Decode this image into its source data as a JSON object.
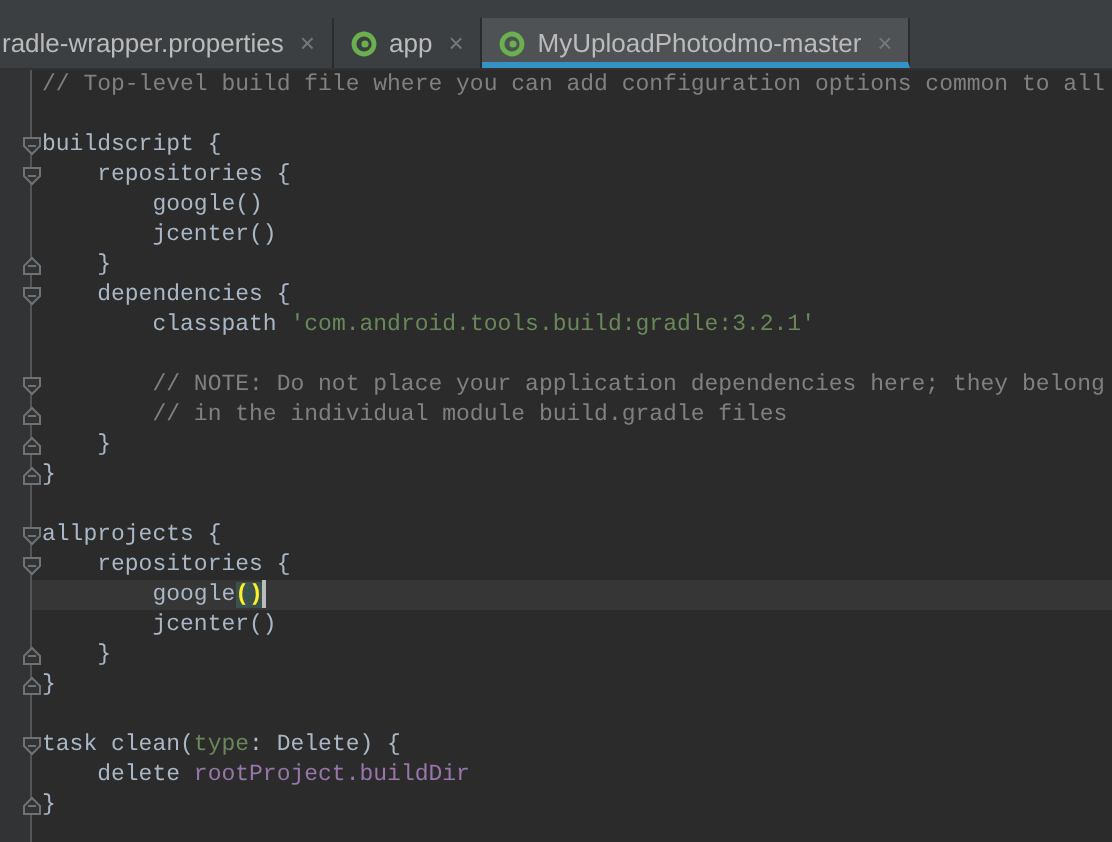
{
  "tabs": [
    {
      "label": "radle-wrapper.properties",
      "icon": false,
      "close": "×",
      "selected": false
    },
    {
      "label": "app",
      "icon": true,
      "close": "×",
      "selected": false
    },
    {
      "label": "MyUploadPhotodmo-master",
      "icon": true,
      "close": "×",
      "selected": true
    }
  ],
  "editor": {
    "lines": [
      {
        "fold_start": false,
        "fold_end": false,
        "segments": [
          {
            "kind": "comment",
            "text": "// Top-level build file where you can add configuration options common to all"
          }
        ]
      },
      {
        "fold_start": false,
        "fold_end": false
      },
      {
        "fold_start": true,
        "fold_end": false,
        "segments": [
          {
            "kind": "plain",
            "text": "buildscript {"
          }
        ]
      },
      {
        "fold_start": true,
        "fold_end": false,
        "segments": [
          {
            "kind": "plain",
            "text": "    repositories {"
          }
        ]
      },
      {
        "fold_start": false,
        "fold_end": false,
        "segments": [
          {
            "kind": "plain",
            "text": "        google()"
          }
        ]
      },
      {
        "fold_start": false,
        "fold_end": false,
        "segments": [
          {
            "kind": "plain",
            "text": "        jcenter()"
          }
        ]
      },
      {
        "fold_start": false,
        "fold_end": true,
        "segments": [
          {
            "kind": "plain",
            "text": "    }"
          }
        ]
      },
      {
        "fold_start": true,
        "fold_end": false,
        "segments": [
          {
            "kind": "plain",
            "text": "    dependencies {"
          }
        ]
      },
      {
        "fold_start": false,
        "fold_end": false,
        "segments": [
          {
            "kind": "plain",
            "text": "        classpath "
          },
          {
            "kind": "string",
            "text": "'com.android.tools.build:gradle:3.2.1'"
          }
        ]
      },
      {
        "fold_start": false,
        "fold_end": false
      },
      {
        "fold_start": true,
        "fold_end": false,
        "segments": [
          {
            "kind": "comment",
            "text": "        // NOTE: Do not place your application dependencies here; they belong"
          }
        ]
      },
      {
        "fold_start": false,
        "fold_end": true,
        "segments": [
          {
            "kind": "comment",
            "text": "        // in the individual module build.gradle files"
          }
        ]
      },
      {
        "fold_start": false,
        "fold_end": true,
        "segments": [
          {
            "kind": "plain",
            "text": "    }"
          }
        ]
      },
      {
        "fold_start": false,
        "fold_end": true,
        "segments": [
          {
            "kind": "plain",
            "text": "}"
          }
        ]
      },
      {
        "fold_start": false,
        "fold_end": false
      },
      {
        "fold_start": true,
        "fold_end": false,
        "segments": [
          {
            "kind": "plain",
            "text": "allprojects {"
          }
        ]
      },
      {
        "fold_start": true,
        "fold_end": false,
        "segments": [
          {
            "kind": "plain",
            "text": "    repositories {"
          }
        ]
      },
      {
        "fold_start": false,
        "fold_end": false,
        "caret": true,
        "segments": [
          {
            "kind": "plain",
            "text": "        google"
          },
          {
            "kind": "match",
            "text": "()"
          }
        ]
      },
      {
        "fold_start": false,
        "fold_end": false,
        "segments": [
          {
            "kind": "plain",
            "text": "        jcenter()"
          }
        ]
      },
      {
        "fold_start": false,
        "fold_end": true,
        "segments": [
          {
            "kind": "plain",
            "text": "    }"
          }
        ]
      },
      {
        "fold_start": false,
        "fold_end": true,
        "segments": [
          {
            "kind": "plain",
            "text": "}"
          }
        ]
      },
      {
        "fold_start": false,
        "fold_end": false
      },
      {
        "fold_start": true,
        "fold_end": false,
        "segments": [
          {
            "kind": "plain",
            "text": "task clean("
          },
          {
            "kind": "param",
            "text": "type"
          },
          {
            "kind": "plain",
            "text": ": Delete) {"
          }
        ]
      },
      {
        "fold_start": false,
        "fold_end": false,
        "segments": [
          {
            "kind": "plain",
            "text": "    delete "
          },
          {
            "kind": "field",
            "text": "rootProject.buildDir"
          }
        ]
      },
      {
        "fold_start": false,
        "fold_end": true,
        "segments": [
          {
            "kind": "plain",
            "text": "}"
          }
        ]
      }
    ]
  }
}
